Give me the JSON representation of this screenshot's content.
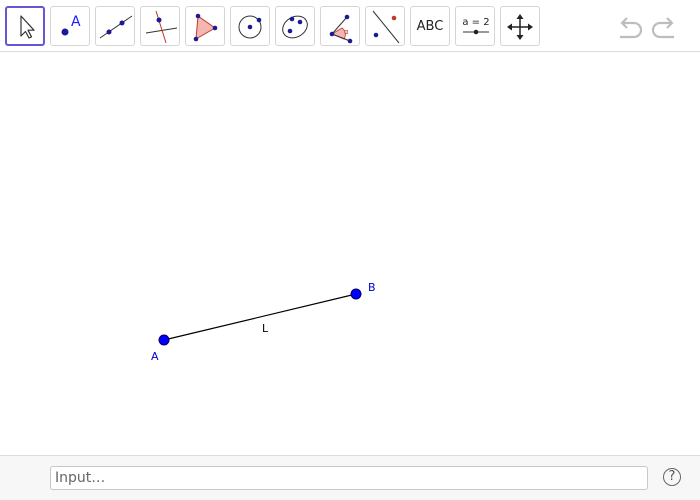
{
  "toolbar": {
    "tools": [
      {
        "name": "Move",
        "icon": "move-arrow-icon",
        "active": true
      },
      {
        "name": "Point",
        "icon": "point-icon"
      },
      {
        "name": "Line",
        "icon": "line-icon"
      },
      {
        "name": "Perpendicular Line",
        "icon": "perpendicular-line-icon"
      },
      {
        "name": "Polygon",
        "icon": "polygon-icon"
      },
      {
        "name": "Circle with Center",
        "icon": "circle-icon"
      },
      {
        "name": "Ellipse",
        "icon": "ellipse-icon"
      },
      {
        "name": "Angle",
        "icon": "angle-icon"
      },
      {
        "name": "Reflect about Line",
        "icon": "reflect-icon"
      },
      {
        "name": "Text",
        "icon": "text-icon",
        "label": "ABC"
      },
      {
        "name": "Slider",
        "icon": "slider-icon",
        "label": "a = 2"
      },
      {
        "name": "Move Graphics View",
        "icon": "pan-icon"
      }
    ],
    "undo_icon": "undo-icon",
    "redo_icon": "redo-icon"
  },
  "canvas": {
    "points": [
      {
        "label": "A",
        "color": "#1a1aff"
      },
      {
        "label": "B",
        "color": "#1a1aff"
      }
    ],
    "segment_label": "L"
  },
  "inputbar": {
    "placeholder": "Input…",
    "help_label": "?"
  },
  "colors": {
    "point": "#0000ff",
    "point_label": "#0000cc",
    "active_tool_border": "#6557d2",
    "polygon_fill": "#f4b6b0",
    "polygon_stroke": "#c0392b"
  }
}
